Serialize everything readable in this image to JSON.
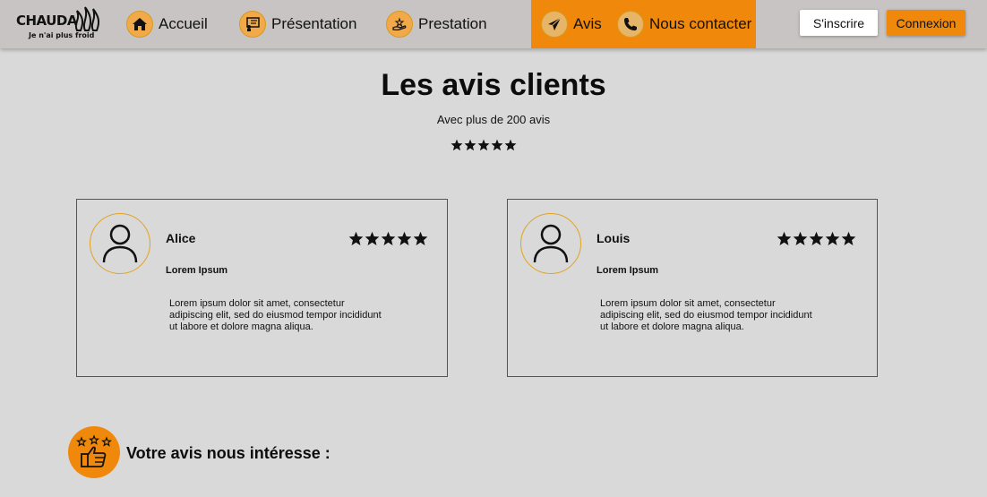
{
  "logo": {
    "brand": "CHAUDA",
    "tagline": "Je n'ai plus froid"
  },
  "nav": {
    "items": [
      {
        "label": "Accueil",
        "icon": "home-icon"
      },
      {
        "label": "Présentation",
        "icon": "presentation-icon"
      },
      {
        "label": "Prestation",
        "icon": "service-hand-icon"
      },
      {
        "label": "Avis",
        "icon": "paper-plane-icon",
        "active": true
      },
      {
        "label": "Nous contacter",
        "icon": "phone-icon",
        "active": true
      }
    ],
    "signup_label": "S'inscrire",
    "login_label": "Connexion"
  },
  "header": {
    "title": "Les avis clients",
    "subtitle": "Avec plus de 200 avis",
    "rating": 5
  },
  "reviews": [
    {
      "name": "Alice",
      "rating": 5,
      "subtitle": "Lorem Ipsum",
      "text": "Lorem ipsum dolor sit amet, consectetur adipiscing elit, sed do eiusmod tempor incididunt ut labore et dolore magna aliqua."
    },
    {
      "name": "Louis",
      "rating": 5,
      "subtitle": "Lorem Ipsum",
      "text": "Lorem ipsum dolor sit amet, consectetur adipiscing elit, sed do eiusmod tempor incididunt ut labore et dolore magna aliqua."
    }
  ],
  "cta": {
    "text": "Votre avis nous intéresse :",
    "icon": "thumbs-up-stars-icon"
  },
  "colors": {
    "accent": "#f0890b",
    "navbar": "#c7c4c3",
    "background": "#d9d9d9",
    "icon_ring": "#e0a320"
  }
}
